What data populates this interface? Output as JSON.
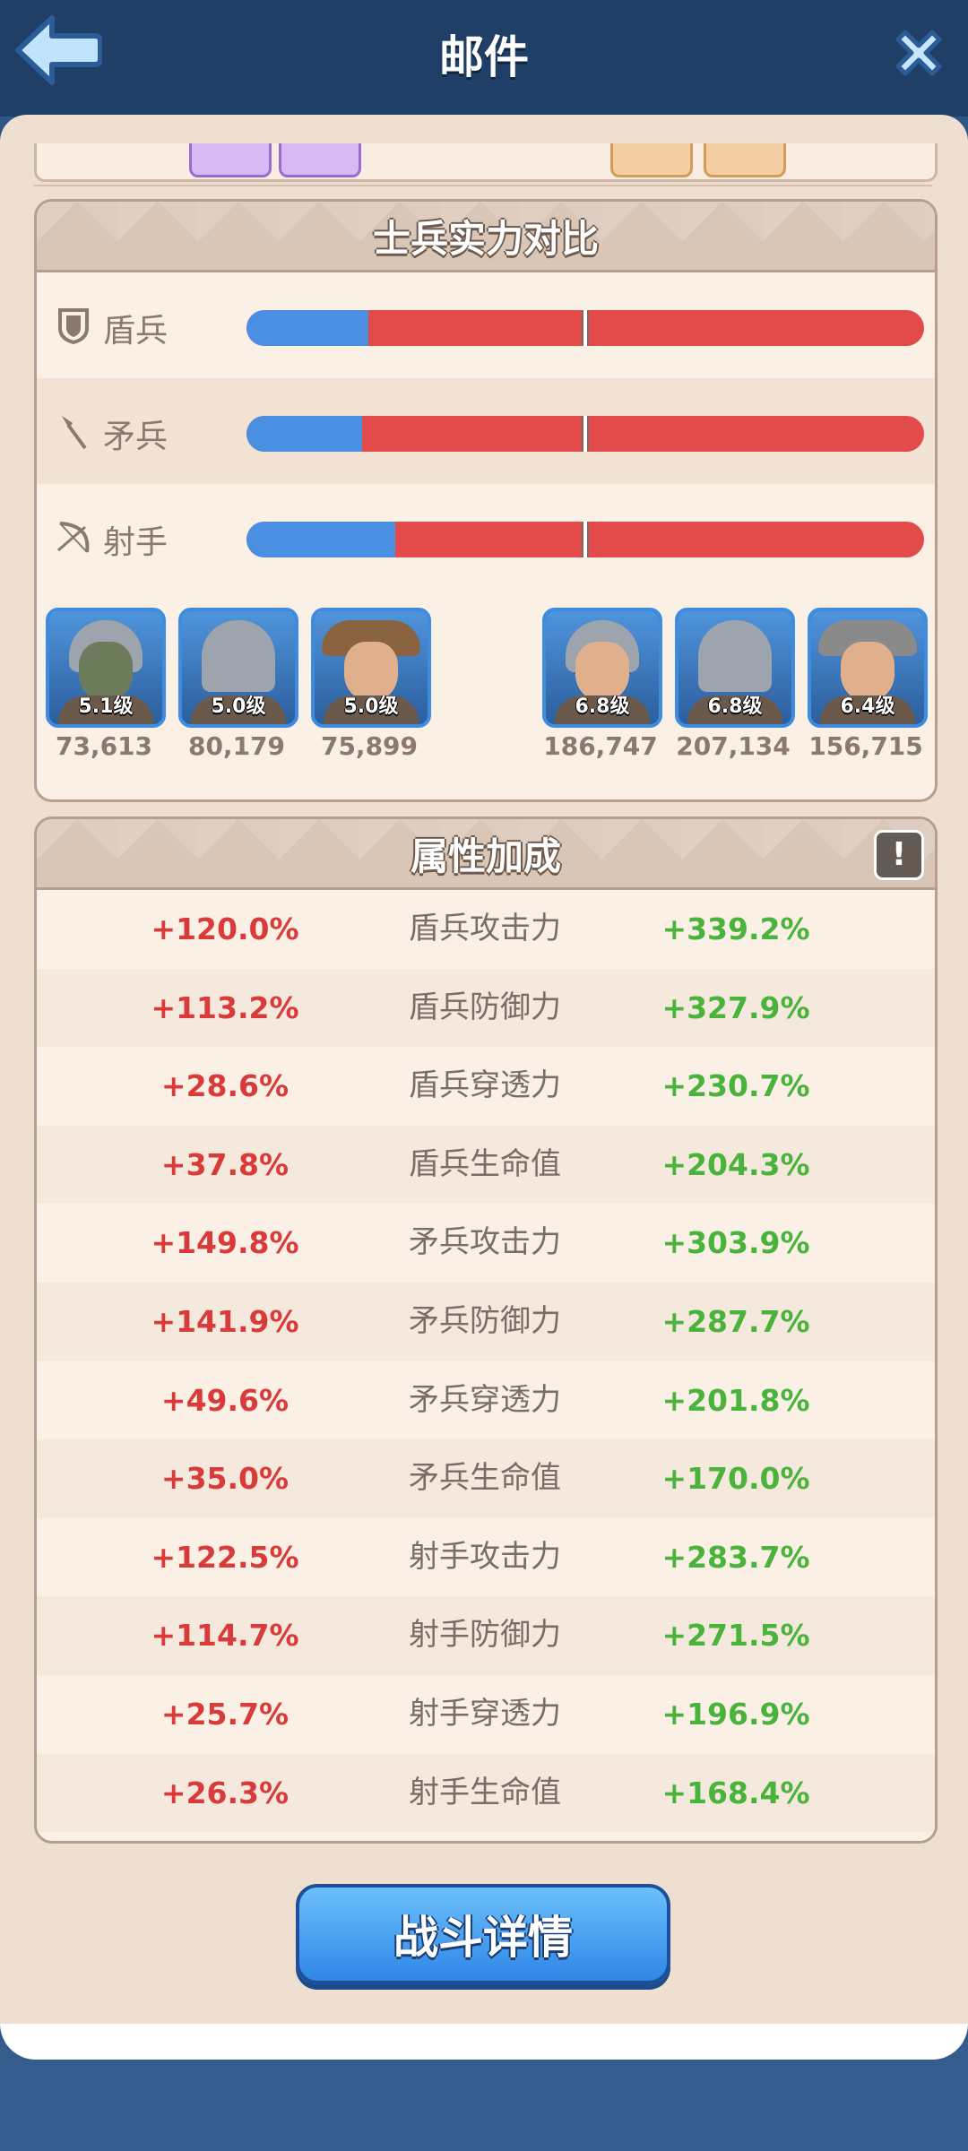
{
  "header": {
    "title": "邮件"
  },
  "soldier_compare": {
    "title": "士兵实力对比",
    "rows": [
      {
        "label": "盾兵",
        "icon": "shield-icon",
        "blue_fraction": 0.18
      },
      {
        "label": "矛兵",
        "icon": "spear-icon",
        "blue_fraction": 0.17
      },
      {
        "label": "射手",
        "icon": "bow-icon",
        "blue_fraction": 0.22
      }
    ],
    "units_left": [
      {
        "level": "5.1级",
        "count": "73,613"
      },
      {
        "level": "5.0级",
        "count": "80,179"
      },
      {
        "level": "5.0级",
        "count": "75,899"
      }
    ],
    "units_right": [
      {
        "level": "6.8级",
        "count": "186,747"
      },
      {
        "level": "6.8级",
        "count": "207,134"
      },
      {
        "level": "6.4级",
        "count": "156,715"
      }
    ]
  },
  "attributes": {
    "title": "属性加成",
    "info_label": "!",
    "rows": [
      {
        "left": "+120.0%",
        "name": "盾兵攻击力",
        "right": "+339.2%"
      },
      {
        "left": "+113.2%",
        "name": "盾兵防御力",
        "right": "+327.9%"
      },
      {
        "left": "+28.6%",
        "name": "盾兵穿透力",
        "right": "+230.7%"
      },
      {
        "left": "+37.8%",
        "name": "盾兵生命值",
        "right": "+204.3%"
      },
      {
        "left": "+149.8%",
        "name": "矛兵攻击力",
        "right": "+303.9%"
      },
      {
        "left": "+141.9%",
        "name": "矛兵防御力",
        "right": "+287.7%"
      },
      {
        "left": "+49.6%",
        "name": "矛兵穿透力",
        "right": "+201.8%"
      },
      {
        "left": "+35.0%",
        "name": "矛兵生命值",
        "right": "+170.0%"
      },
      {
        "left": "+122.5%",
        "name": "射手攻击力",
        "right": "+283.7%"
      },
      {
        "left": "+114.7%",
        "name": "射手防御力",
        "right": "+271.5%"
      },
      {
        "left": "+25.7%",
        "name": "射手穿透力",
        "right": "+196.9%"
      },
      {
        "left": "+26.3%",
        "name": "射手生命值",
        "right": "+168.4%"
      }
    ]
  },
  "battle_button": {
    "label": "战斗详情"
  },
  "colors": {
    "ally": "#4b8fe2",
    "enemy": "#e34a4a",
    "positive_ally": "#d93b3b",
    "positive_enemy": "#4ab33b"
  }
}
